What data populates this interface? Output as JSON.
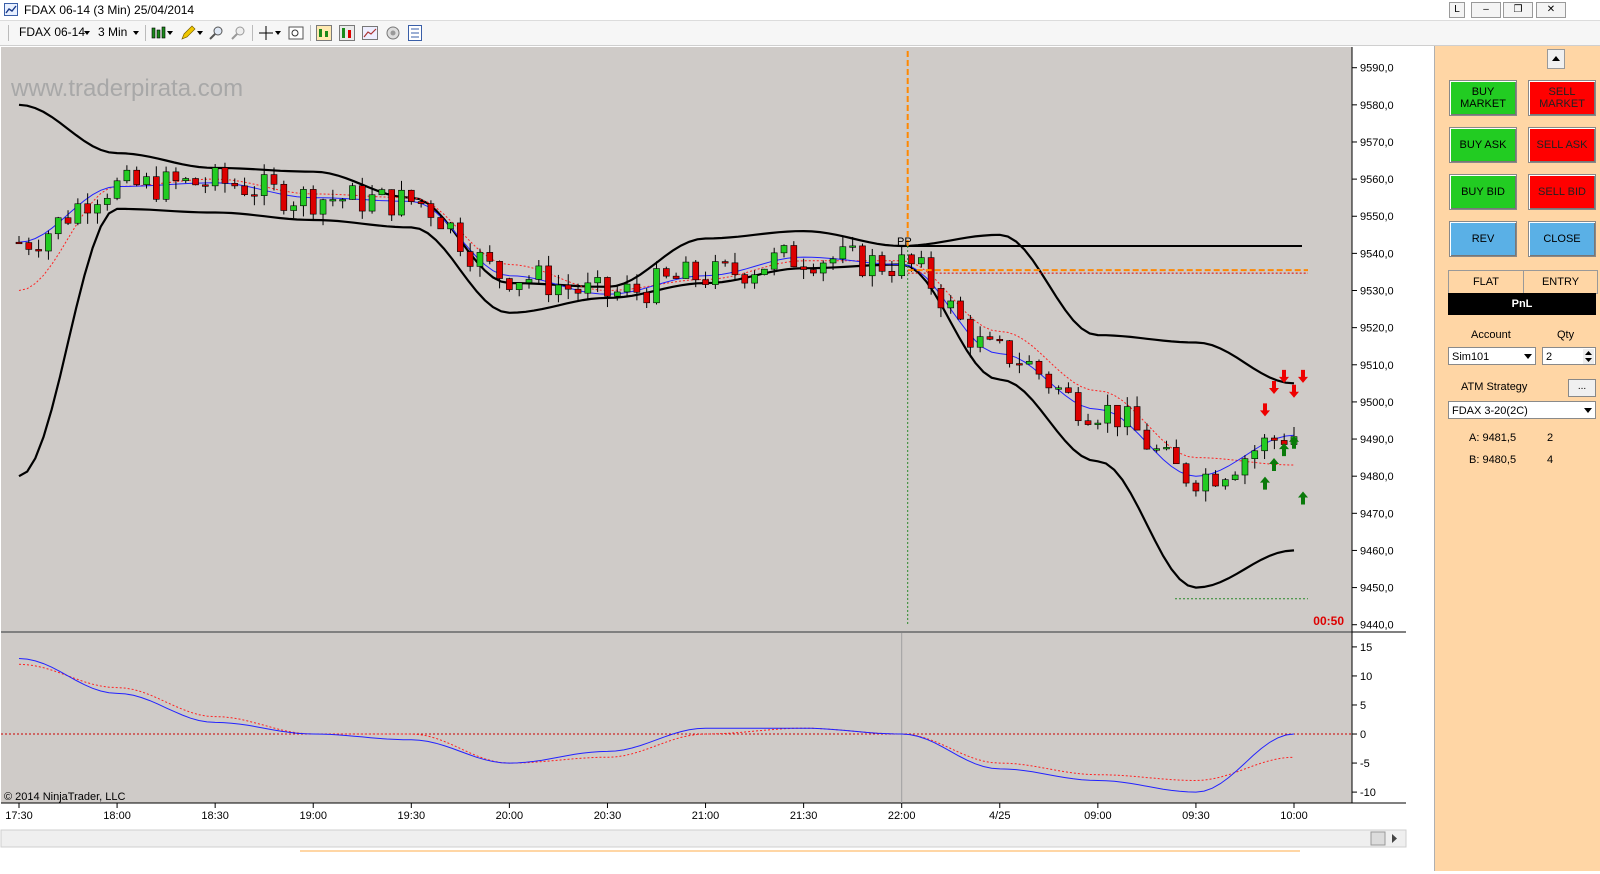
{
  "window": {
    "title": "FDAX 06-14 (3 Min)  25/04/2014",
    "buttons": [
      "L",
      "–",
      "❐",
      "✕"
    ]
  },
  "toolbar": {
    "instrument": "FDAX 06-14",
    "interval": "3 Min"
  },
  "chart": {
    "watermark": "www.traderpirata.com",
    "copyright": "© 2014 NinjaTrader, LLC",
    "countdown": "00:50",
    "pp_label": "PP",
    "price_axis": [
      "9590,0",
      "9580,0",
      "9570,0",
      "9560,0",
      "9550,0",
      "9540,0",
      "9530,0",
      "9520,0",
      "9510,0",
      "9500,0",
      "9490,0",
      "9480,0",
      "9470,0",
      "9460,0",
      "9450,0",
      "9440,0"
    ],
    "osc_axis": [
      "15",
      "10",
      "5",
      "0",
      "-5",
      "-10"
    ],
    "time_axis": [
      "17:30",
      "18:00",
      "18:30",
      "19:00",
      "19:30",
      "20:00",
      "20:30",
      "21:00",
      "21:30",
      "22:00",
      "4/25",
      "09:00",
      "09:30",
      "10:00"
    ],
    "colors": {
      "background": "#cfcbc8",
      "bull_candle": "#22cc22",
      "bear_candle": "#dd0000",
      "bollinger": "#000000",
      "ema_fast": "#2222ff",
      "ema_slow": "#ff2222",
      "pivot_marker": "#ff8800"
    }
  },
  "chart_data": {
    "type": "line",
    "title": "FDAX 06-14 (3 Min)",
    "x": [
      "17:30",
      "18:00",
      "18:30",
      "19:00",
      "19:30",
      "20:00",
      "20:30",
      "21:00",
      "21:30",
      "22:00",
      "4/25",
      "09:00",
      "09:30",
      "10:00"
    ],
    "series": [
      {
        "name": "Bollinger upper",
        "values": [
          9580,
          9567,
          9563,
          9562,
          9555,
          9532,
          9531,
          9544,
          9546,
          9542,
          9545,
          9518,
          9516,
          9505
        ]
      },
      {
        "name": "Bollinger lower",
        "values": [
          9480,
          9552,
          9551,
          9549,
          9547,
          9524,
          9528,
          9532,
          9536,
          9537,
          9506,
          9484,
          9450,
          9460
        ]
      },
      {
        "name": "EMA fast",
        "values": [
          9543,
          9558,
          9559,
          9555,
          9554,
          9534,
          9529,
          9534,
          9539,
          9537,
          9513,
          9498,
          9480,
          9491
        ]
      },
      {
        "name": "EMA slow",
        "values": [
          9530,
          9558,
          9560,
          9556,
          9555,
          9537,
          9530,
          9533,
          9538,
          9538,
          9519,
          9503,
          9485,
          9483
        ]
      },
      {
        "name": "Oscillator",
        "values": [
          13,
          7,
          2,
          0,
          -1,
          -5,
          -3,
          1,
          1,
          0,
          -6,
          -8,
          -10,
          0
        ]
      },
      {
        "name": "Oscillator signal",
        "values": [
          12,
          8,
          3,
          0,
          0,
          -5,
          -4,
          0,
          1,
          0,
          -5,
          -7,
          -8,
          -4
        ]
      }
    ],
    "levels": {
      "pivot": 9542,
      "entry": 9535.5,
      "low_marker": 9447
    },
    "ylim": [
      9440,
      9592
    ],
    "osc_ylim": [
      -11,
      16
    ]
  },
  "panel": {
    "buy_market": "BUY MARKET",
    "sell_market": "SELL MARKET",
    "buy_ask": "BUY ASK",
    "sell_ask": "SELL ASK",
    "buy_bid": "BUY BID",
    "sell_bid": "SELL BID",
    "rev": "REV",
    "close": "CLOSE",
    "flat": "FLAT",
    "entry": "ENTRY",
    "pnl": "PnL",
    "account_label": "Account",
    "qty_label": "Qty",
    "account_value": "Sim101",
    "qty_value": "2",
    "atm_label": "ATM Strategy",
    "atm_button": "...",
    "atm_value": "FDAX 3-20(2C)",
    "ask_label": "A: 9481,5",
    "ask_size": "2",
    "bid_label": "B: 9480,5",
    "bid_size": "4"
  }
}
